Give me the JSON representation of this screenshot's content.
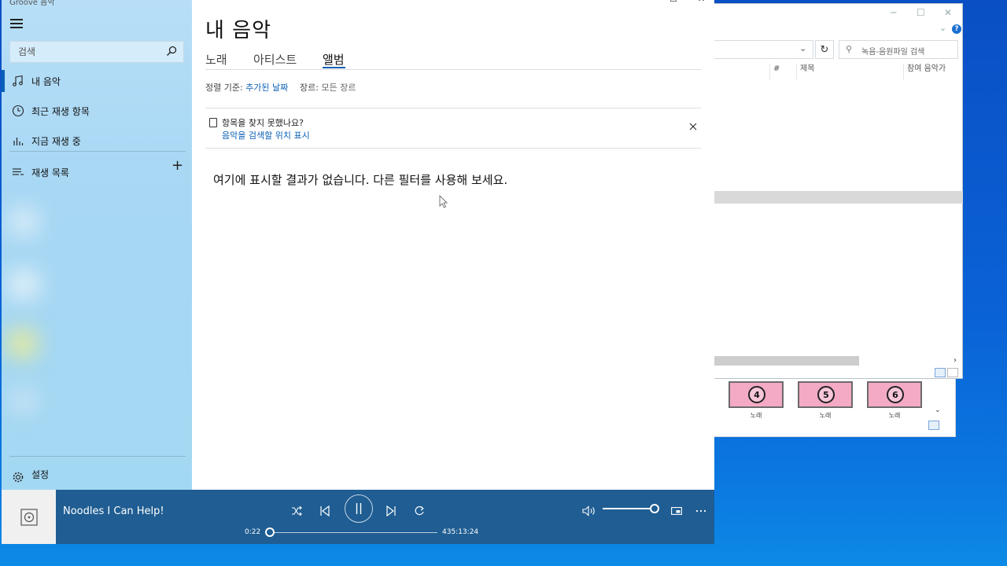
{
  "groove": {
    "app_title": "Groove 음악",
    "search_placeholder": "검색",
    "nav": [
      {
        "label": "내 음악",
        "icon": "music-note-icon"
      },
      {
        "label": "최근 재생 항목",
        "icon": "clock-icon"
      },
      {
        "label": "지금 재생 중",
        "icon": "equalizer-icon"
      },
      {
        "label": "재생 목록",
        "icon": "playlist-icon"
      }
    ],
    "settings_label": "설정",
    "page_title": "내 음악",
    "tabs": [
      "노래",
      "아티스트",
      "앨범"
    ],
    "active_tab": "앨범",
    "sort_label": "정렬 기준:",
    "sort_value": "추가된 날짜",
    "genre_label": "장르:",
    "genre_value": "모든 장르",
    "notice_title": "항목을 찾지 못했나요?",
    "notice_link": "음악을 검색할 위치 표시",
    "empty_message": "여기에 표시할 결과가 없습니다. 다른 필터를 사용해 보세요.",
    "player": {
      "track": "Noodles I Can Help!",
      "elapsed": "0:22",
      "total": "435:13:24",
      "progress": 0.0,
      "volume": 1.0
    }
  },
  "explorer": {
    "search_placeholder": "녹음-음원파일 검색",
    "columns": [
      "#",
      "제목",
      "참여 음악가"
    ],
    "thumbnails": [
      {
        "num": "4",
        "label": "노래"
      },
      {
        "num": "5",
        "label": "노래"
      },
      {
        "num": "6",
        "label": "노래"
      }
    ]
  },
  "colors": {
    "accent": "#0a5fb4",
    "player_bg": "#1f5d92",
    "sidebar_bg": "#a7d7f4"
  }
}
